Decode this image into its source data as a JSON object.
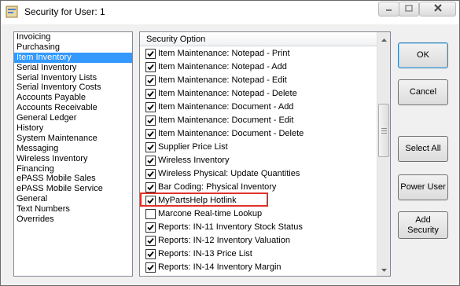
{
  "window": {
    "title": "Security for User: 1"
  },
  "categories": [
    "Invoicing",
    "Purchasing",
    "Item Inventory",
    "Serial Inventory",
    "Serial Inventory Lists",
    "Serial Inventory Costs",
    "Accounts Payable",
    "Accounts Receivable",
    "General Ledger",
    "History",
    "System Maintenance",
    "Messaging",
    "Wireless Inventory",
    "Financing",
    "ePASS Mobile Sales",
    "ePASS Mobile Service",
    "General",
    "Text Numbers",
    "Overrides"
  ],
  "selected_category": "Item Inventory",
  "options_header": "Security Option",
  "options": [
    {
      "label": "Item Maintenance: Notepad - Print",
      "checked": true
    },
    {
      "label": "Item Maintenance: Notepad - Add",
      "checked": true
    },
    {
      "label": "Item Maintenance: Notepad - Edit",
      "checked": true
    },
    {
      "label": "Item Maintenance: Notepad - Delete",
      "checked": true
    },
    {
      "label": "Item Maintenance: Document - Add",
      "checked": true
    },
    {
      "label": "Item Maintenance: Document - Edit",
      "checked": true
    },
    {
      "label": "Item Maintenance: Document - Delete",
      "checked": true
    },
    {
      "label": "Supplier Price List",
      "checked": true
    },
    {
      "label": "Wireless Inventory",
      "checked": true
    },
    {
      "label": "Wireless Physical: Update Quantities",
      "checked": true
    },
    {
      "label": "Bar Coding: Physical Inventory",
      "checked": true
    },
    {
      "label": "MyPartsHelp Hotlink",
      "checked": true
    },
    {
      "label": "Marcone Real-time Lookup",
      "checked": false
    },
    {
      "label": "Reports: IN-11 Inventory Stock Status",
      "checked": true
    },
    {
      "label": "Reports: IN-12 Inventory Valuation",
      "checked": true
    },
    {
      "label": "Reports: IN-13 Price List",
      "checked": true
    },
    {
      "label": "Reports: IN-14 Inventory Margin",
      "checked": true
    }
  ],
  "buttons": {
    "ok": "OK",
    "cancel": "Cancel",
    "select_all": "Select All",
    "power_user": "Power User",
    "add_security": "Add Security"
  },
  "colors": {
    "selection": "#3399ff",
    "highlight_box": "#e0302a"
  }
}
